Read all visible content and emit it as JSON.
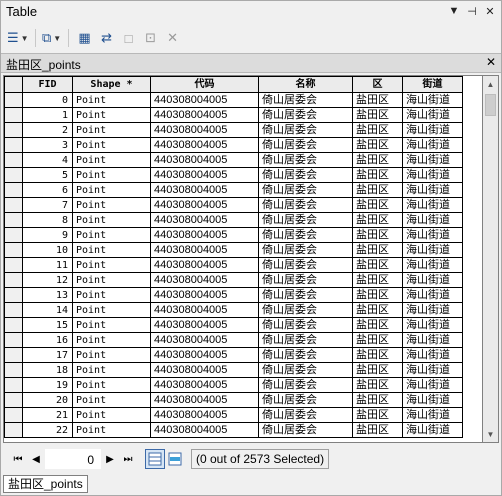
{
  "window": {
    "title": "Table"
  },
  "toolbar": {
    "items": [
      {
        "name": "table-options-icon",
        "glyph": "☰"
      },
      {
        "name": "related-tables-icon",
        "glyph": "⧉"
      },
      {
        "name": "select-by-attributes-icon",
        "glyph": "▦"
      },
      {
        "name": "switch-selection-icon",
        "glyph": "⇄"
      },
      {
        "name": "clear-selection-icon",
        "glyph": "□"
      },
      {
        "name": "zoom-to-selected-icon",
        "glyph": "⊡"
      },
      {
        "name": "delete-selected-icon",
        "glyph": "✕"
      }
    ]
  },
  "tab": {
    "name": "盐田区_points"
  },
  "table": {
    "columns": [
      "FID",
      "Shape *",
      "代码",
      "名称",
      "区",
      "街道"
    ],
    "rows": [
      [
        "0",
        "Point",
        "440308004005",
        "倚山居委会",
        "盐田区",
        "海山街道"
      ],
      [
        "1",
        "Point",
        "440308004005",
        "倚山居委会",
        "盐田区",
        "海山街道"
      ],
      [
        "2",
        "Point",
        "440308004005",
        "倚山居委会",
        "盐田区",
        "海山街道"
      ],
      [
        "3",
        "Point",
        "440308004005",
        "倚山居委会",
        "盐田区",
        "海山街道"
      ],
      [
        "4",
        "Point",
        "440308004005",
        "倚山居委会",
        "盐田区",
        "海山街道"
      ],
      [
        "5",
        "Point",
        "440308004005",
        "倚山居委会",
        "盐田区",
        "海山街道"
      ],
      [
        "6",
        "Point",
        "440308004005",
        "倚山居委会",
        "盐田区",
        "海山街道"
      ],
      [
        "7",
        "Point",
        "440308004005",
        "倚山居委会",
        "盐田区",
        "海山街道"
      ],
      [
        "8",
        "Point",
        "440308004005",
        "倚山居委会",
        "盐田区",
        "海山街道"
      ],
      [
        "9",
        "Point",
        "440308004005",
        "倚山居委会",
        "盐田区",
        "海山街道"
      ],
      [
        "10",
        "Point",
        "440308004005",
        "倚山居委会",
        "盐田区",
        "海山街道"
      ],
      [
        "11",
        "Point",
        "440308004005",
        "倚山居委会",
        "盐田区",
        "海山街道"
      ],
      [
        "12",
        "Point",
        "440308004005",
        "倚山居委会",
        "盐田区",
        "海山街道"
      ],
      [
        "13",
        "Point",
        "440308004005",
        "倚山居委会",
        "盐田区",
        "海山街道"
      ],
      [
        "14",
        "Point",
        "440308004005",
        "倚山居委会",
        "盐田区",
        "海山街道"
      ],
      [
        "15",
        "Point",
        "440308004005",
        "倚山居委会",
        "盐田区",
        "海山街道"
      ],
      [
        "16",
        "Point",
        "440308004005",
        "倚山居委会",
        "盐田区",
        "海山街道"
      ],
      [
        "17",
        "Point",
        "440308004005",
        "倚山居委会",
        "盐田区",
        "海山街道"
      ],
      [
        "18",
        "Point",
        "440308004005",
        "倚山居委会",
        "盐田区",
        "海山街道"
      ],
      [
        "19",
        "Point",
        "440308004005",
        "倚山居委会",
        "盐田区",
        "海山街道"
      ],
      [
        "20",
        "Point",
        "440308004005",
        "倚山居委会",
        "盐田区",
        "海山街道"
      ],
      [
        "21",
        "Point",
        "440308004005",
        "倚山居委会",
        "盐田区",
        "海山街道"
      ],
      [
        "22",
        "Point",
        "440308004005",
        "倚山居委会",
        "盐田区",
        "海山街道"
      ]
    ]
  },
  "navigator": {
    "current_record": "0",
    "status": "(0 out of 2573 Selected)"
  },
  "bottom_tab": {
    "label": "盐田区_points"
  }
}
